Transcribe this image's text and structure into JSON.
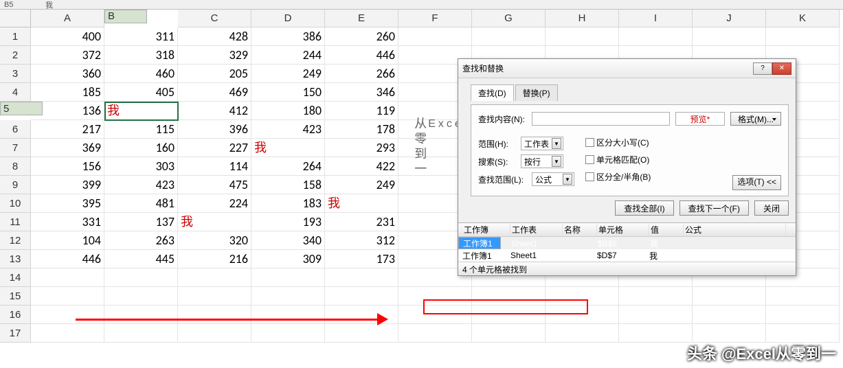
{
  "topbar": {
    "cellref": "B5",
    "formula": "我"
  },
  "columns": [
    "A",
    "B",
    "C",
    "D",
    "E",
    "F",
    "G",
    "H",
    "I",
    "J",
    "K"
  ],
  "rows": [
    1,
    2,
    3,
    4,
    5,
    6,
    7,
    8,
    9,
    10,
    11,
    12,
    13,
    14,
    15,
    16,
    17
  ],
  "data": {
    "1": [
      "400",
      "311",
      "428",
      "386",
      "260"
    ],
    "2": [
      "372",
      "318",
      "329",
      "244",
      "446"
    ],
    "3": [
      "360",
      "460",
      "205",
      "249",
      "266"
    ],
    "4": [
      "185",
      "405",
      "469",
      "150",
      "346"
    ],
    "5": [
      "136",
      "我",
      "412",
      "180",
      "119"
    ],
    "6": [
      "217",
      "115",
      "396",
      "423",
      "178"
    ],
    "7": [
      "369",
      "160",
      "227",
      "我",
      "293"
    ],
    "8": [
      "156",
      "303",
      "114",
      "264",
      "422"
    ],
    "9": [
      "399",
      "423",
      "475",
      "158",
      "249"
    ],
    "10": [
      "395",
      "481",
      "224",
      "183",
      "我"
    ],
    "11": [
      "331",
      "137",
      "我",
      "193",
      "231"
    ],
    "12": [
      "104",
      "263",
      "320",
      "340",
      "312"
    ],
    "13": [
      "446",
      "445",
      "216",
      "309",
      "173"
    ]
  },
  "red_cells": [
    "5-1",
    "7-3",
    "10-4",
    "11-2"
  ],
  "watermark": {
    "at": "@",
    "en": "Excel",
    "cn": "从零到一"
  },
  "attribution": "头条 @Excel从零到一",
  "dialog": {
    "title": "查找和替换",
    "help_icon": "?",
    "close_icon": "✕",
    "tabs": {
      "find": "查找(D)",
      "replace": "替换(P)"
    },
    "find_label": "查找内容(N):",
    "find_value": "",
    "preview": "预览*",
    "format": "格式(M)...",
    "scope_label": "范围(H):",
    "scope_value": "工作表",
    "search_label": "搜索(S):",
    "search_value": "按行",
    "lookin_label": "查找范围(L):",
    "lookin_value": "公式",
    "chk_case": "区分大小写(C)",
    "chk_whole": "单元格匹配(O)",
    "chk_width": "区分全/半角(B)",
    "options": "选项(T) <<",
    "find_all": "查找全部(I)",
    "find_next": "查找下一个(F)",
    "close": "关闭",
    "cols": {
      "book": "工作簿",
      "sheet": "工作表",
      "name": "名称",
      "cell": "单元格",
      "value": "值",
      "formula": "公式"
    },
    "results": [
      {
        "book": "工作簿1",
        "sheet": "Sheet1",
        "name": "",
        "cell": "$B$5",
        "value": "我",
        "sel": true
      },
      {
        "book": "工作簿1",
        "sheet": "Sheet1",
        "name": "",
        "cell": "$D$7",
        "value": "我",
        "sel": false
      }
    ],
    "status": "4 个单元格被找到"
  }
}
